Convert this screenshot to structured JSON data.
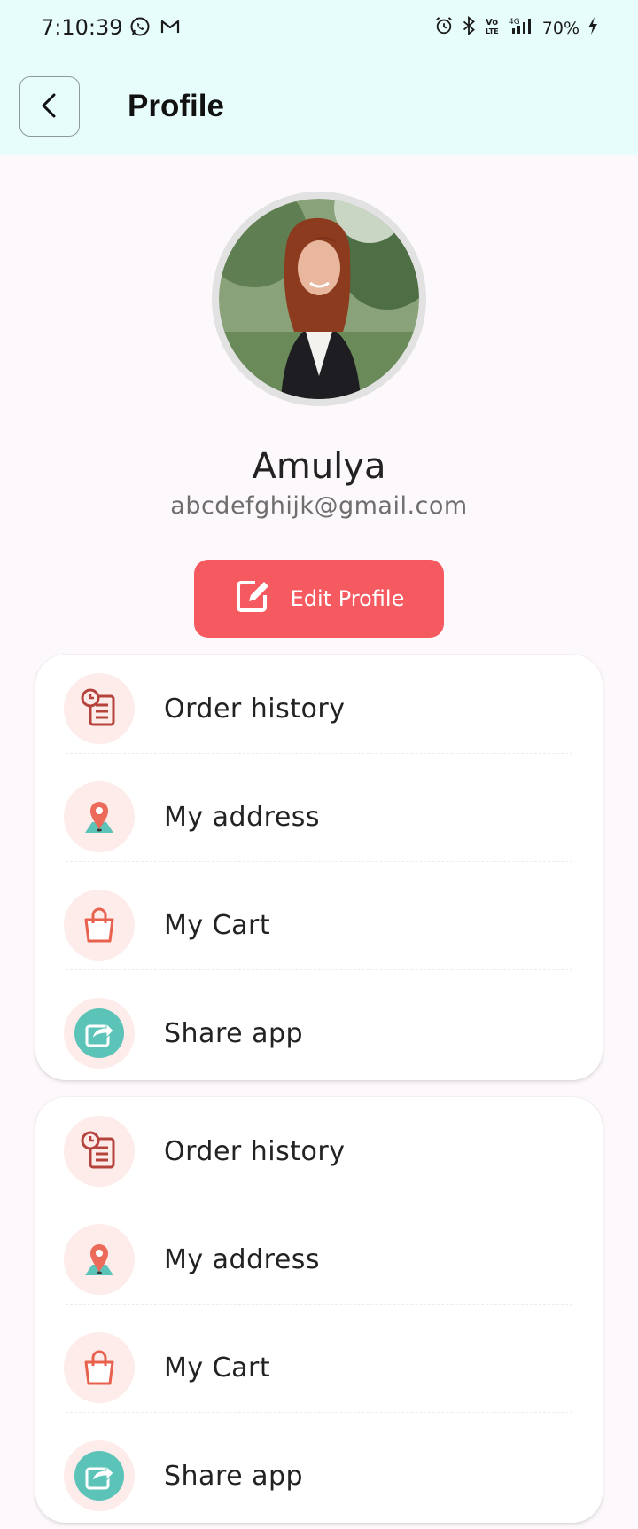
{
  "status_bar": {
    "time": "7:10:39",
    "battery": "70%"
  },
  "header": {
    "title": "Profile"
  },
  "profile": {
    "name": "Amulya",
    "email": "abcdefghijk@gmail.com",
    "edit_label": "Edit Profile"
  },
  "menu_groups": [
    {
      "items": [
        {
          "label": "Order history",
          "icon": "order-history-icon"
        },
        {
          "label": "My address",
          "icon": "location-pin-icon"
        },
        {
          "label": "My Cart",
          "icon": "shopping-bag-icon"
        },
        {
          "label": "Share app",
          "icon": "share-icon"
        }
      ]
    },
    {
      "items": [
        {
          "label": "Order history",
          "icon": "order-history-icon"
        },
        {
          "label": "My address",
          "icon": "location-pin-icon"
        },
        {
          "label": "My Cart",
          "icon": "shopping-bag-icon"
        },
        {
          "label": "Share app",
          "icon": "share-icon"
        }
      ]
    }
  ],
  "colors": {
    "header_bg": "#e7fdfb",
    "accent": "#f55a60",
    "icon_bg": "#fdecea",
    "share_icon": "#5cc3b8"
  }
}
